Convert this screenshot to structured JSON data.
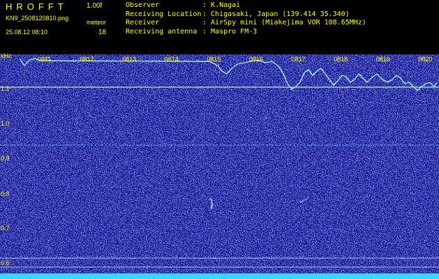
{
  "header": {
    "title": "HROFFT",
    "version": "1.00f",
    "filename": "KN9_2508120810.png",
    "timestamp": "25.08.12 08:10",
    "meteor_label": "meteor",
    "meteor_count": "18"
  },
  "info": [
    {
      "key": "Observer",
      "value": ": K.Nagai"
    },
    {
      "key": "Receiving Location",
      "value": ": Chigasaki, Japan (139.414 35.340)"
    },
    {
      "key": "Receiver",
      "value": ": AirSpy mini (Miakejima VOR 108.65MHz)"
    },
    {
      "key": "Receiving antenna",
      "value": ": Maspro FM-3"
    }
  ],
  "axis": {
    "unit": "kHz",
    "y_ticks": [
      "1.1",
      "1.0",
      "0.9",
      "0.8",
      "0.7",
      "0.6"
    ],
    "time_ticks": [
      "0811",
      "0812",
      "0813",
      "0814",
      "0815",
      "0816",
      "0817",
      "0818",
      "0819",
      "0820"
    ]
  },
  "colors": {
    "background": "#1a1fa0",
    "text": "#ffff00",
    "trace": "#9ff0d0",
    "bottom_band": "#33d9ff"
  }
}
